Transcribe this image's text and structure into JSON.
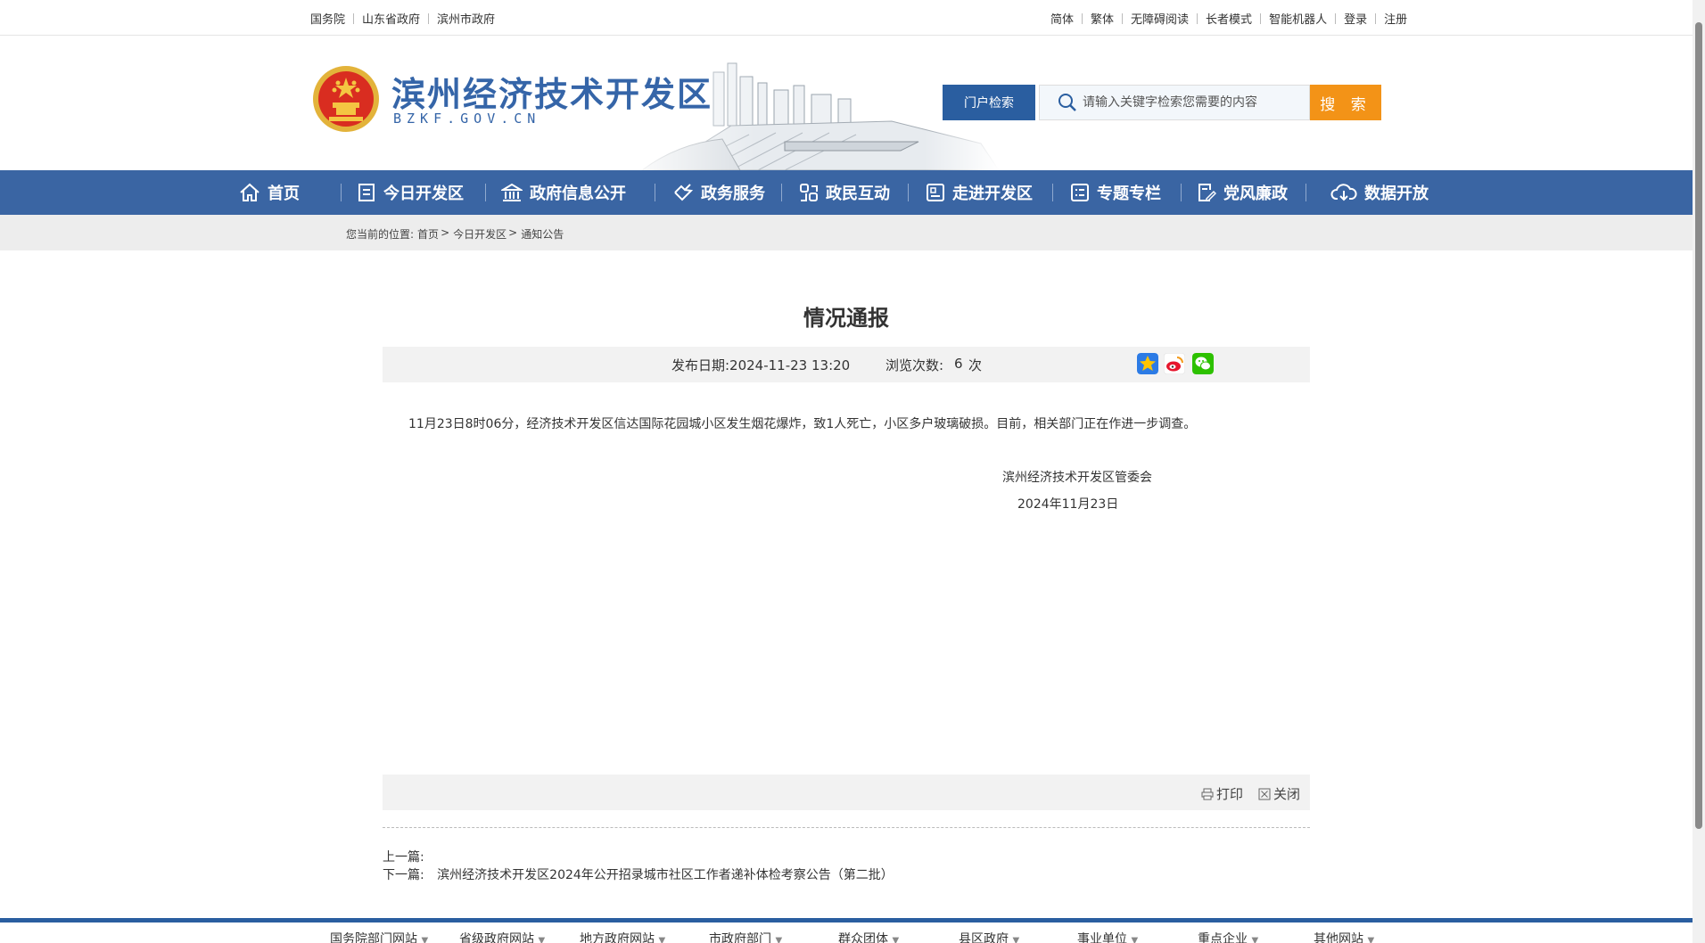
{
  "topbar": {
    "left_links": [
      "国务院",
      "山东省政府",
      "滨州市政府"
    ],
    "right_links": [
      "简体",
      "繁体",
      "无障碍阅读",
      "长者模式",
      "智能机器人",
      "登录",
      "注册"
    ]
  },
  "header": {
    "title": "滨州经济技术开发区",
    "subtitle": "BZKF.GOV.CN",
    "search_label": "门户检索",
    "search_placeholder": "请输入关键字检索您需要的内容",
    "search_button": "搜 索"
  },
  "nav": {
    "items": [
      "首页",
      "今日开发区",
      "政府信息公开",
      "政务服务",
      "政民互动",
      "走进开发区",
      "专题专栏",
      "党风廉政",
      "数据开放"
    ]
  },
  "breadcrumb": {
    "prefix": "您当前的位置:",
    "items": [
      "首页",
      "今日开发区",
      "通知公告"
    ]
  },
  "article": {
    "title": "情况通报",
    "date_label": "发布日期:2024-11-23 13:20",
    "views_label": "浏览次数:",
    "views_count": "6",
    "views_unit": "次",
    "body": "11月23日8时06分，经济技术开发区信达国际花园城小区发生烟花爆炸，致1人死亡，小区多户玻璃破损。目前，相关部门正在作进一步调查。",
    "signature_org": "滨州经济技术开发区管委会",
    "signature_date": "2024年11月23日"
  },
  "tools": {
    "print": "打印",
    "close": "关闭"
  },
  "prevnext": {
    "prev_label": "上一篇:",
    "next_label": "下一篇:",
    "next_title": "滨州经济技术开发区2024年公开招录城市社区工作者递补体检考察公告（第二批）"
  },
  "footer": {
    "links": [
      "国务院部门网站",
      "省级政府网站",
      "地方政府网站",
      "市政府部门",
      "群众团体",
      "县区政府",
      "事业单位",
      "重点企业",
      "其他网站"
    ]
  },
  "colors": {
    "brand_blue": "#3a65a3",
    "search_orange": "#f39317"
  }
}
